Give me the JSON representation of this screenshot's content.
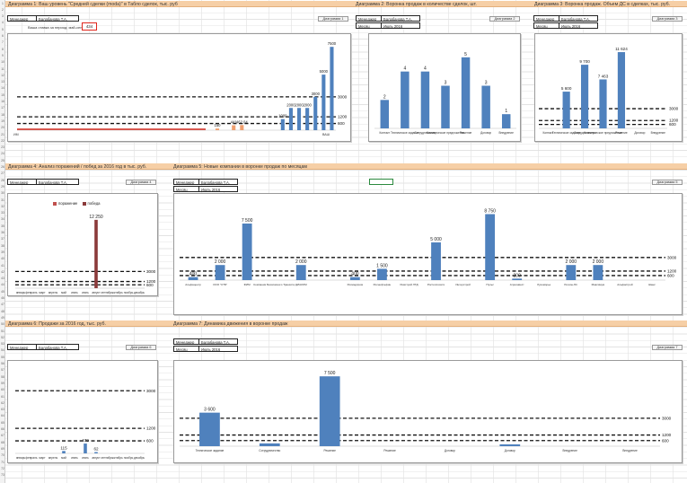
{
  "ui": {
    "header_name_label": "Менеджер",
    "header_name_value": "Балабанова Т.А.",
    "header_month_label": "Месяц",
    "header_month_value": "Июль 2016",
    "input_note": "Ваша ставка за период: май-сентябрь",
    "input_value": "434",
    "nav_buttons": [
      "Диаграмма 1",
      "Диаграмма 2",
      "Диаграмма 3",
      "Диаграмма 4",
      "Диаграмма 5",
      "Диаграмма 6",
      "Диаграмма 7"
    ],
    "colors": {
      "bar": "#4f81bd",
      "bar_red": "#c0504d",
      "bar_dark": "#8b3a3a",
      "band": "#f6cfa6",
      "ref_line": "#111111"
    }
  },
  "chart_data": [
    {
      "id": 1,
      "type": "bar",
      "title": "Диаграмма 1: Ваш уровень \"Средней сделки (moda)\" в Табло сделок, тыс. руб",
      "values": [
        0,
        0,
        0,
        0,
        0,
        0,
        0,
        0,
        0,
        0,
        0,
        0,
        0,
        0,
        0,
        0,
        0,
        0,
        0,
        0,
        0,
        0,
        0,
        0,
        150,
        0,
        441,
        462.04,
        0,
        0,
        0,
        0,
        1000,
        2000,
        2000,
        2000,
        3000,
        5000,
        7500
      ],
      "value_labels": [
        "",
        "",
        "",
        "",
        "",
        "",
        "",
        "",
        "",
        "",
        "",
        "",
        "",
        "",
        "",
        "",
        "",
        "",
        "",
        "",
        "",
        "",
        "",
        "",
        "150",
        "",
        "441",
        "462,04",
        "",
        "",
        "",
        "",
        "1000",
        "2000",
        "2000",
        "2000",
        "3000",
        "5000",
        "7500"
      ],
      "reference_lines": [
        3000,
        1200,
        600
      ],
      "ref_labels": [
        "3000",
        "1200",
        "600"
      ],
      "x_first_label": "ИМ",
      "x_last_label": "ВАШ",
      "ylim": [
        0,
        8000
      ]
    },
    {
      "id": 2,
      "type": "bar",
      "title": "Диаграмма 2: Воронка продаж в количестве сделок, шт.",
      "categories": [
        "Контакт",
        "Техническое задание",
        "Сотрудничество",
        "Коммерческое предложение",
        "Решение",
        "Договор",
        "Внедрение"
      ],
      "values": [
        2,
        4,
        4,
        3,
        5,
        3,
        1
      ],
      "value_labels": [
        "2",
        "4",
        "4",
        "3",
        "5",
        "3",
        "1"
      ],
      "ylim": [
        0,
        6
      ]
    },
    {
      "id": 3,
      "type": "bar",
      "title": "Диаграмма 3: Воронка продаж. Объем ДС в сделках, тыс. руб.",
      "categories": [
        "Контакт",
        "Техническое задание",
        "Сотрудничество",
        "Коммерческое предложение",
        "Решение",
        "Договор",
        "Внедрение"
      ],
      "values": [
        0,
        5600,
        9700,
        7463,
        11624,
        0,
        0
      ],
      "value_labels": [
        "",
        "5 600",
        "9 700",
        "7 463",
        "11 624",
        "",
        ""
      ],
      "reference_lines": [
        3000,
        1200,
        600
      ],
      "ref_labels": [
        "3000",
        "1200",
        "600"
      ],
      "ylim": [
        0,
        13000
      ]
    },
    {
      "id": 4,
      "type": "bar",
      "title": "Диаграмма 4: Анализ поражений / побед за 2016 год в тыс. руб.",
      "categories": [
        "январь",
        "февраль",
        "март",
        "апрель",
        "май",
        "июнь",
        "июль",
        "август",
        "сентябрь",
        "октябрь",
        "ноябрь",
        "декабрь"
      ],
      "series": [
        {
          "name": "поражение",
          "values": [
            0,
            0,
            0,
            0,
            0,
            0,
            0,
            0,
            0,
            0,
            0,
            0
          ]
        },
        {
          "name": "победа",
          "values": [
            0,
            0,
            0,
            0,
            0,
            0,
            0,
            12250,
            0,
            0,
            0,
            0
          ]
        }
      ],
      "value_labels": [
        "",
        "",
        "",
        "",
        "",
        "",
        "",
        "12 250",
        "",
        "",
        "",
        ""
      ],
      "reference_lines": [
        3000,
        1200,
        600
      ],
      "ref_labels": [
        "3000",
        "1200",
        "600"
      ],
      "ylim": [
        0,
        14000
      ]
    },
    {
      "id": 5,
      "type": "bar",
      "title": "Диаграмма 5: Новые компании в воронке продаж по месяцам",
      "values": [
        400,
        2000,
        7500,
        0,
        2000,
        0,
        400,
        1500,
        0,
        5000,
        0,
        8750,
        200,
        0,
        2000,
        2000,
        0,
        0
      ],
      "value_labels": [
        "400",
        "2 000",
        "7 500",
        "",
        "2 000",
        "",
        "400",
        "1 500",
        "",
        "5 000",
        "",
        "8 750",
        "200",
        "",
        "2 000",
        "2 000",
        "",
        ""
      ],
      "categories": [
        "Альфацентр",
        "ООО \"СТБ\"",
        "ФИМ",
        "Компания Безопасного Транзита",
        "ДИАКОМ",
        "",
        "Росмедпром",
        "Роснефтьфин",
        "Ремстрой ЛТД",
        "Ростеплосети",
        "Интерстрой",
        "Пульс",
        "Агроинвест",
        "Лукоморье",
        "Регион-Юг",
        "Максимум",
        "Альфастрой",
        "Шанс"
      ],
      "reference_lines": [
        3000,
        1200,
        600
      ],
      "ref_labels": [
        "3000",
        "1200",
        "600"
      ],
      "ylim": [
        0,
        10000
      ]
    },
    {
      "id": 6,
      "type": "bar",
      "title": "Диаграмма 6: Продажи за 2016 год, тыс. руб.",
      "categories": [
        "январь",
        "февраль",
        "март",
        "апрель",
        "май",
        "июнь",
        "июль",
        "август",
        "сентябрь",
        "октябрь",
        "ноябрь",
        "декабрь"
      ],
      "values": [
        0,
        0,
        0,
        0,
        115,
        0,
        470,
        62,
        0,
        0,
        0,
        0
      ],
      "value_labels": [
        "",
        "",
        "",
        "",
        "115",
        "",
        "470",
        "62",
        "",
        "",
        "",
        ""
      ],
      "reference_lines": [
        3000,
        1200,
        600
      ],
      "ref_labels": [
        "3000",
        "1200",
        "600"
      ],
      "ylim": [
        0,
        4000
      ]
    },
    {
      "id": 7,
      "type": "bar",
      "title": "Диаграмма 7: Динамика движения в воронке продаж",
      "categories": [
        "Техническое задание",
        "Сотрудничество",
        "Решение",
        "Решение",
        "Договор",
        "Договор",
        "Внедрение",
        "Внедрение"
      ],
      "values": [
        3600,
        300,
        7500,
        0,
        0,
        200,
        0,
        0
      ],
      "value_labels": [
        "3 600",
        "",
        "7 500",
        "",
        "",
        "",
        "",
        ""
      ],
      "reference_lines": [
        3000,
        1200,
        600
      ],
      "ref_labels": [
        "3000",
        "1200",
        "600"
      ],
      "ylim": [
        0,
        8000
      ]
    }
  ]
}
